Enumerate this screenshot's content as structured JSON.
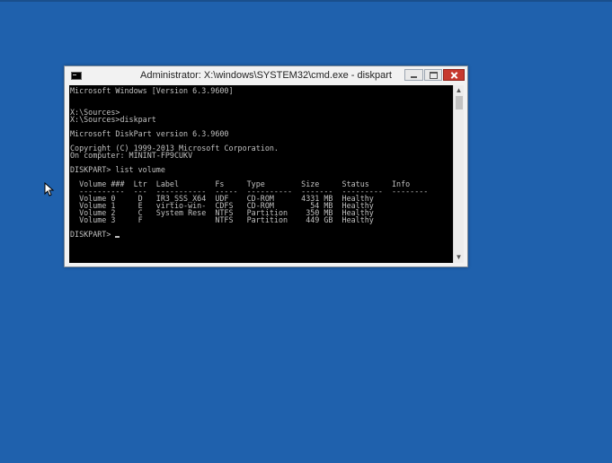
{
  "window": {
    "title": "Administrator: X:\\windows\\SYSTEM32\\cmd.exe - diskpart",
    "icon": "cmd-icon"
  },
  "console": {
    "lines_before_cursor": "Microsoft Windows [Version 6.3.9600]\n\n\nX:\\Sources>\nX:\\Sources>diskpart\n\nMicrosoft DiskPart version 6.3.9600\n\nCopyright (C) 1999-2013 Microsoft Corporation.\nOn computer: MININT-FP9CUKV\n\nDISKPART> list volume\n\n  Volume ###  Ltr  Label        Fs     Type        Size     Status     Info\n  ----------  ---  -----------  -----  ----------  -------  ---------  --------\n  Volume 0     D   IR3_SSS_X64  UDF    CD-ROM      4331 MB  Healthy\n  Volume 1     E   virtio-win-  CDFS   CD-ROM        54 MB  Healthy\n  Volume 2     C   System Rese  NTFS   Partition    350 MB  Healthy\n  Volume 3     F                NTFS   Partition    449 GB  Healthy\n\n",
    "prompt": "DISKPART> "
  },
  "colors": {
    "desktop": "#1f61ad",
    "console_bg": "#000000",
    "console_fg": "#c0c0c0",
    "close_button": "#c7392f"
  }
}
